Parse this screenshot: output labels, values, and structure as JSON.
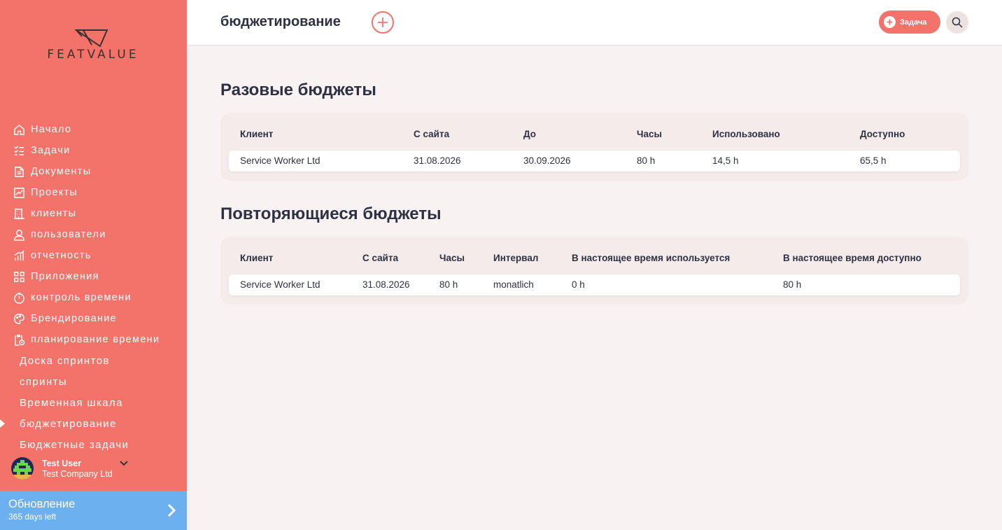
{
  "sidebar": {
    "logo_text": "FEATVALUE",
    "items": [
      {
        "label": "Начало",
        "icon": "home-icon"
      },
      {
        "label": "Задачи",
        "icon": "tasks-list-icon"
      },
      {
        "label": "Документы",
        "icon": "documents-icon"
      },
      {
        "label": "Проекты",
        "icon": "projects-chart-icon"
      },
      {
        "label": "клиенты",
        "icon": "building-icon"
      },
      {
        "label": "пользователи",
        "icon": "user-icon"
      },
      {
        "label": "отчетность",
        "icon": "reporting-bars-icon"
      },
      {
        "label": "Приложения",
        "icon": "apps-grid-icon"
      },
      {
        "label": "контроль времени",
        "icon": "stopwatch-icon"
      },
      {
        "label": "Брендирование",
        "icon": "palette-icon"
      },
      {
        "label": "планирование времени",
        "icon": "clipboard-clock-icon"
      }
    ],
    "subitems": [
      {
        "label": "Доска спринтов"
      },
      {
        "label": "спринты"
      },
      {
        "label": "Временная шкала"
      },
      {
        "label": "бюджетирование",
        "active": true
      },
      {
        "label": "Бюджетные задачи"
      }
    ],
    "user": {
      "name": "Test User",
      "company": "Test Company Ltd"
    },
    "update": {
      "title": "Обновление",
      "subtitle": "365 days left"
    }
  },
  "header": {
    "title": "бюджетирование",
    "task_button": "Задача"
  },
  "one_time": {
    "title": "Разовые бюджеты",
    "columns": [
      "Клиент",
      "С сайта",
      "До",
      "Часы",
      "Использовано",
      "Доступно"
    ],
    "rows": [
      [
        "Service Worker Ltd",
        "31.08.2026",
        "30.09.2026",
        "80 h",
        "14,5 h",
        "65,5 h"
      ]
    ]
  },
  "recurring": {
    "title": "Повторяющиеся бюджеты",
    "columns": [
      "Клиент",
      "С сайта",
      "Часы",
      "Интервал",
      "В настоящее время используется",
      "В настоящее время доступно"
    ],
    "rows": [
      [
        "Service Worker Ltd",
        "31.08.2026",
        "80 h",
        "monatlich",
        "0 h",
        "80 h"
      ]
    ]
  },
  "colors": {
    "accent": "#f3736a",
    "update_bar": "#6cb0f0",
    "background": "#f8f3f2",
    "text": "#2d3142"
  }
}
